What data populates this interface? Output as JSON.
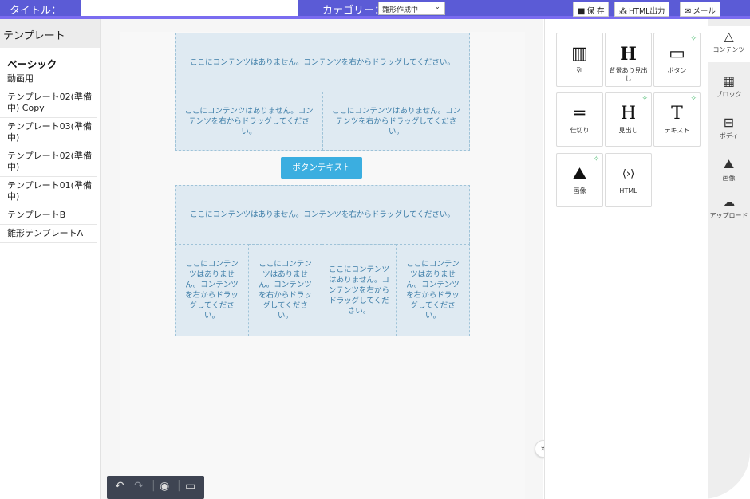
{
  "topbar": {
    "title_label": "タイトル：",
    "category_label": "カテゴリー：",
    "category_value": "雛形作成中",
    "save": "保 存",
    "html_out": "HTML出力",
    "mail": "メール"
  },
  "left": {
    "heading": "テンプレート",
    "basic": "ベーシック",
    "items": [
      "動画用",
      "テンプレート02(準備中) Copy",
      "テンプレート03(準備中)",
      "テンプレート02(準備中)",
      "テンプレート01(準備中)",
      "テンプレートB",
      "雛形テンプレートA"
    ]
  },
  "canvas": {
    "empty_full": "ここにコンテンツはありません。コンテンツを右からドラッグしてください。",
    "empty_half": "ここにコンテンツはありません。コンテンツを右からドラッグしてください。",
    "empty_quarter": "ここにコンテンツはありません。コンテンツを右からドラッグしてください。",
    "button_text": "ボタンテキスト"
  },
  "tiles": {
    "col": "列",
    "heading_bg": "背景あり見出し",
    "button": "ボタン",
    "divider": "仕切り",
    "heading": "見出し",
    "text": "テキスト",
    "image": "画像",
    "html": "HTML"
  },
  "rail": {
    "contents": "コンテンツ",
    "block": "ブロック",
    "body": "ボディ",
    "image": "画像",
    "upload": "アップロード"
  },
  "icons": {
    "undo": "undo-icon",
    "redo": "redo-icon",
    "preview": "eye-icon",
    "desktop": "monitor-icon",
    "expand": "double-chevron-right-icon"
  }
}
